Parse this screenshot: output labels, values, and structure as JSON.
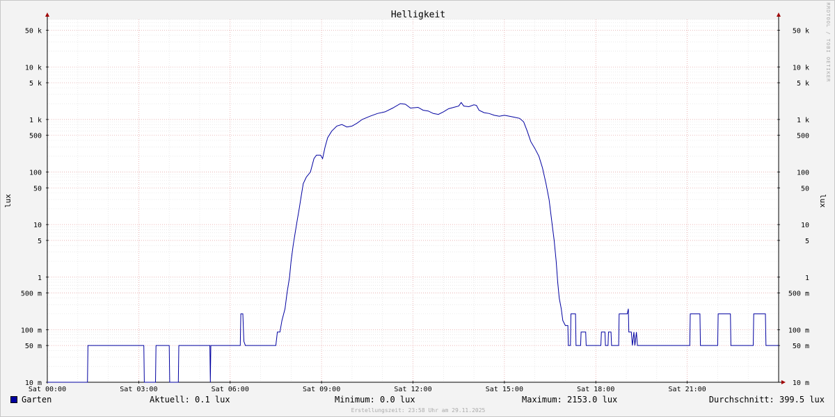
{
  "chart_data": {
    "type": "line",
    "title": "Helligkeit",
    "ylabel": "lux",
    "yscale": "log",
    "ylim": [
      0.01,
      80000
    ],
    "xlim": [
      "Sat 00:00",
      "Sat 24:00"
    ],
    "x_tick_labels": [
      "Sat 00:00",
      "Sat 03:00",
      "Sat 06:00",
      "Sat 09:00",
      "Sat 12:00",
      "Sat 15:00",
      "Sat 18:00",
      "Sat 21:00"
    ],
    "y_ticks": [
      {
        "value": 0.01,
        "label": "10 m"
      },
      {
        "value": 0.05,
        "label": "50 m"
      },
      {
        "value": 0.1,
        "label": "100 m"
      },
      {
        "value": 0.5,
        "label": "500 m"
      },
      {
        "value": 1,
        "label": "1"
      },
      {
        "value": 5,
        "label": "5"
      },
      {
        "value": 10,
        "label": "10"
      },
      {
        "value": 50,
        "label": "50"
      },
      {
        "value": 100,
        "label": "100"
      },
      {
        "value": 500,
        "label": "500"
      },
      {
        "value": 1000,
        "label": "1 k"
      },
      {
        "value": 5000,
        "label": "5 k"
      },
      {
        "value": 10000,
        "label": "10 k"
      },
      {
        "value": 50000,
        "label": "50 k"
      }
    ],
    "grid": true,
    "series": [
      {
        "name": "Garten",
        "color": "#0000a0",
        "points": [
          [
            "00:00",
            0.0
          ],
          [
            "01:19",
            0.0
          ],
          [
            "01:20",
            0.05
          ],
          [
            "03:10",
            0.05
          ],
          [
            "03:11",
            0.0
          ],
          [
            "03:33",
            0.0
          ],
          [
            "03:34",
            0.05
          ],
          [
            "04:00",
            0.05
          ],
          [
            "04:01",
            0.0
          ],
          [
            "04:18",
            0.0
          ],
          [
            "04:19",
            0.05
          ],
          [
            "05:20",
            0.05
          ],
          [
            "05:21",
            0.0
          ],
          [
            "05:22",
            0.05
          ],
          [
            "06:20",
            0.05
          ],
          [
            "06:21",
            0.2
          ],
          [
            "06:25",
            0.2
          ],
          [
            "06:27",
            0.06
          ],
          [
            "06:30",
            0.05
          ],
          [
            "07:30",
            0.05
          ],
          [
            "07:33",
            0.09
          ],
          [
            "07:38",
            0.09
          ],
          [
            "07:42",
            0.15
          ],
          [
            "07:48",
            0.25
          ],
          [
            "07:52",
            0.5
          ],
          [
            "07:57",
            1.0
          ],
          [
            "08:00",
            2.0
          ],
          [
            "08:04",
            4.0
          ],
          [
            "08:08",
            7.0
          ],
          [
            "08:12",
            12.0
          ],
          [
            "08:16",
            20.0
          ],
          [
            "08:20",
            35.0
          ],
          [
            "08:24",
            60.0
          ],
          [
            "08:30",
            80.0
          ],
          [
            "08:38",
            100.0
          ],
          [
            "08:45",
            180.0
          ],
          [
            "08:50",
            210.0
          ],
          [
            "08:58",
            210.0
          ],
          [
            "09:02",
            180.0
          ],
          [
            "09:07",
            300.0
          ],
          [
            "09:12",
            450.0
          ],
          [
            "09:20",
            600.0
          ],
          [
            "09:30",
            750.0
          ],
          [
            "09:40",
            800.0
          ],
          [
            "09:50",
            720.0
          ],
          [
            "10:00",
            750.0
          ],
          [
            "10:10",
            850.0
          ],
          [
            "10:20",
            1000.0
          ],
          [
            "10:35",
            1150.0
          ],
          [
            "10:50",
            1300.0
          ],
          [
            "11:05",
            1400.0
          ],
          [
            "11:20",
            1650.0
          ],
          [
            "11:35",
            2000.0
          ],
          [
            "11:45",
            1950.0
          ],
          [
            "11:55",
            1650.0
          ],
          [
            "12:10",
            1700.0
          ],
          [
            "12:20",
            1500.0
          ],
          [
            "12:30",
            1450.0
          ],
          [
            "12:40",
            1300.0
          ],
          [
            "12:50",
            1250.0
          ],
          [
            "13:00",
            1400.0
          ],
          [
            "13:10",
            1600.0
          ],
          [
            "13:20",
            1700.0
          ],
          [
            "13:30",
            1800.0
          ],
          [
            "13:35",
            2100.0
          ],
          [
            "13:40",
            1800.0
          ],
          [
            "13:50",
            1750.0
          ],
          [
            "14:00",
            1900.0
          ],
          [
            "14:05",
            1850.0
          ],
          [
            "14:10",
            1500.0
          ],
          [
            "14:20",
            1350.0
          ],
          [
            "14:30",
            1300.0
          ],
          [
            "14:40",
            1200.0
          ],
          [
            "14:50",
            1150.0
          ],
          [
            "15:00",
            1200.0
          ],
          [
            "15:10",
            1150.0
          ],
          [
            "15:20",
            1100.0
          ],
          [
            "15:30",
            1050.0
          ],
          [
            "15:38",
            900.0
          ],
          [
            "15:45",
            600.0
          ],
          [
            "15:52",
            380.0
          ],
          [
            "16:00",
            280.0
          ],
          [
            "16:08",
            200.0
          ],
          [
            "16:15",
            120.0
          ],
          [
            "16:22",
            60.0
          ],
          [
            "16:28",
            30.0
          ],
          [
            "16:33",
            12.0
          ],
          [
            "16:38",
            5.0
          ],
          [
            "16:42",
            2.0
          ],
          [
            "16:45",
            0.8
          ],
          [
            "16:48",
            0.4
          ],
          [
            "16:52",
            0.25
          ],
          [
            "16:55",
            0.15
          ],
          [
            "17:00",
            0.12
          ],
          [
            "17:05",
            0.12
          ],
          [
            "17:06",
            0.05
          ],
          [
            "17:10",
            0.05
          ],
          [
            "17:11",
            0.2
          ],
          [
            "17:20",
            0.2
          ],
          [
            "17:21",
            0.05
          ],
          [
            "17:30",
            0.05
          ],
          [
            "17:31",
            0.09
          ],
          [
            "17:40",
            0.09
          ],
          [
            "17:41",
            0.05
          ],
          [
            "18:10",
            0.05
          ],
          [
            "18:11",
            0.09
          ],
          [
            "18:18",
            0.09
          ],
          [
            "18:19",
            0.05
          ],
          [
            "18:24",
            0.05
          ],
          [
            "18:25",
            0.09
          ],
          [
            "18:30",
            0.09
          ],
          [
            "18:31",
            0.05
          ],
          [
            "18:45",
            0.05
          ],
          [
            "18:46",
            0.2
          ],
          [
            "19:02",
            0.2
          ],
          [
            "19:04",
            0.25
          ],
          [
            "19:05",
            0.09
          ],
          [
            "19:10",
            0.09
          ],
          [
            "19:12",
            0.05
          ],
          [
            "19:15",
            0.09
          ],
          [
            "19:17",
            0.05
          ],
          [
            "19:20",
            0.09
          ],
          [
            "19:22",
            0.05
          ],
          [
            "21:05",
            0.05
          ],
          [
            "21:06",
            0.2
          ],
          [
            "21:25",
            0.2
          ],
          [
            "21:26",
            0.05
          ],
          [
            "22:00",
            0.05
          ],
          [
            "22:01",
            0.2
          ],
          [
            "22:25",
            0.2
          ],
          [
            "22:26",
            0.05
          ],
          [
            "23:10",
            0.05
          ],
          [
            "23:11",
            0.2
          ],
          [
            "23:34",
            0.2
          ],
          [
            "23:35",
            0.05
          ],
          [
            "24:00",
            0.05
          ]
        ]
      }
    ]
  },
  "legend": {
    "series_name": "Garten",
    "aktuell": "Aktuell:   0.1 lux",
    "minimum": "Minimum:   0.0 lux",
    "maximum": "Maximum: 2153.0 lux",
    "durchschnitt": "Durchschnitt: 399.5 lux"
  },
  "watermark": "RRDTOOL / TOBI OETIKER",
  "footer": "Erstellungszeit: 23:58 Uhr am 29.11.2025"
}
